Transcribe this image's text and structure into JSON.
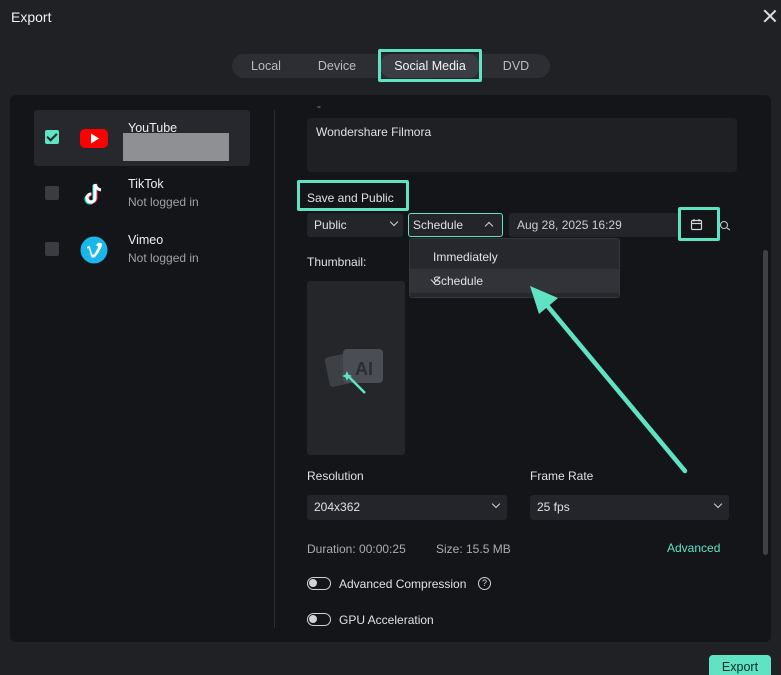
{
  "window": {
    "title": "Export"
  },
  "tabs": [
    {
      "label": "Local"
    },
    {
      "label": "Device"
    },
    {
      "label": "Social Media"
    },
    {
      "label": "DVD"
    }
  ],
  "platforms": [
    {
      "name": "YouTube",
      "status": "",
      "checked": true,
      "icon": "youtube-icon"
    },
    {
      "name": "TikTok",
      "status": "Not logged in",
      "checked": false,
      "icon": "tiktok-icon"
    },
    {
      "name": "Vimeo",
      "status": "Not logged in",
      "checked": false,
      "icon": "vimeo-icon"
    }
  ],
  "form": {
    "description_prefix": "-",
    "description": "Wondershare Filmora",
    "section_label": "Save and Public",
    "privacy": "Public",
    "publish_mode": "Schedule",
    "schedule_datetime": "Aug 28, 2025  16:29",
    "publish_options": [
      "Immediately",
      "Schedule"
    ],
    "thumbnail_label": "Thumbnail:",
    "resolution_label": "Resolution",
    "resolution": "204x362",
    "frame_rate_label": "Frame Rate",
    "frame_rate": "25 fps",
    "duration": "Duration: 00:00:25",
    "size": "Size:  15.5 MB",
    "advanced_link": "Advanced",
    "advanced_compression": "Advanced Compression",
    "gpu_acceleration": "GPU Acceleration",
    "help_glyph": "?"
  },
  "footer": {
    "export_label": "Export"
  },
  "colors": {
    "accent": "#5fe3c3",
    "background": "#1f2125",
    "panel": "#141518",
    "youtube_red": "#ff0000",
    "vimeo_blue": "#1ab7ea"
  }
}
